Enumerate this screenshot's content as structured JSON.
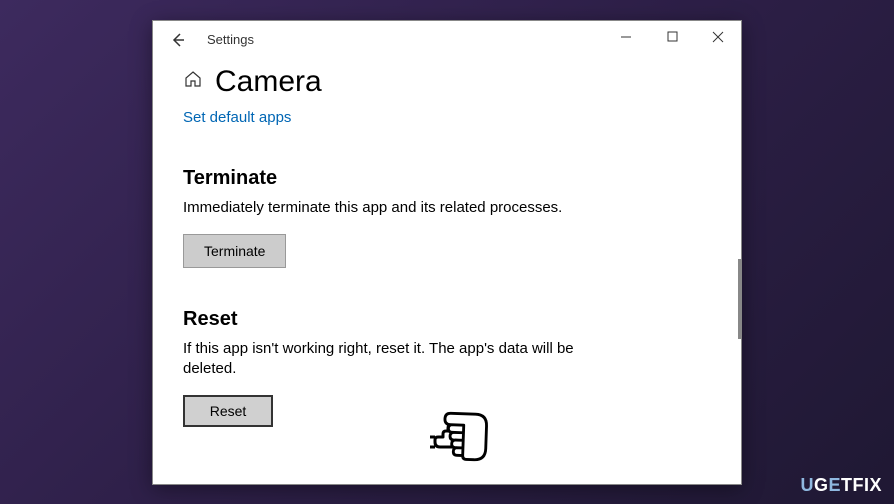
{
  "window": {
    "title": "Settings"
  },
  "page": {
    "title": "Camera",
    "link": "Set default apps"
  },
  "sections": {
    "terminate": {
      "title": "Terminate",
      "description": "Immediately terminate this app and its related processes.",
      "button": "Terminate"
    },
    "reset": {
      "title": "Reset",
      "description": "If this app isn't working right, reset it. The app's data will be deleted.",
      "button": "Reset"
    }
  },
  "watermark": "UGETFIX"
}
